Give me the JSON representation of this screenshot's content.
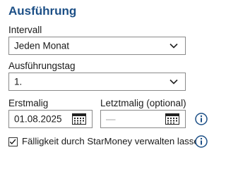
{
  "section": {
    "title": "Ausführung"
  },
  "interval": {
    "label": "Intervall",
    "selected": "Jeden Monat"
  },
  "execution_day": {
    "label": "Ausführungstag",
    "selected": "1."
  },
  "first_date": {
    "label": "Erstmalig",
    "value": "01.08.2025"
  },
  "last_date": {
    "label": "Letztmalig (optional)",
    "placeholder": "—"
  },
  "due_checkbox": {
    "label": "Fälligkeit durch StarMoney verwalten lassen",
    "checked": true
  },
  "icons": {
    "dropdown": "chevron-down-icon",
    "calendar": "calendar-icon",
    "info": "info-icon",
    "check": "checkmark-icon"
  },
  "colors": {
    "title": "#1c4f86",
    "info": "#1c4f86"
  }
}
